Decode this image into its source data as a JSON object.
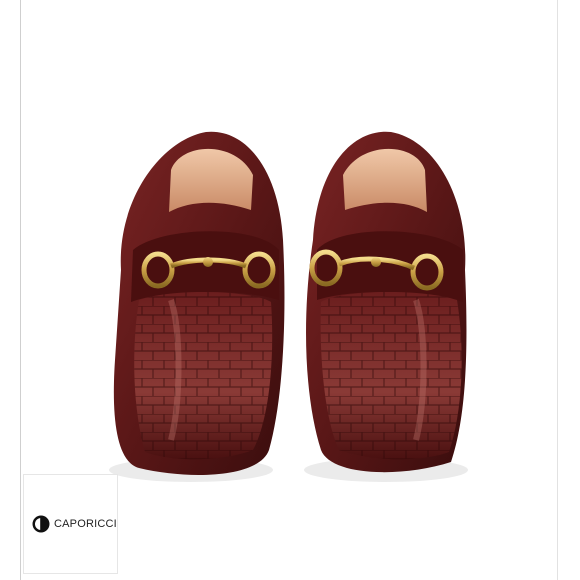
{
  "image": {
    "subject": "pair-of-loafers",
    "colors": {
      "leather": "#5a1717",
      "leather_highlight": "#9a4a44",
      "hardware": "#d8b45a",
      "lining": "#e6b08e",
      "background": "#ffffff"
    }
  },
  "brand": {
    "name": "CAPORICCI",
    "icon": "caporicci-logo-icon"
  }
}
